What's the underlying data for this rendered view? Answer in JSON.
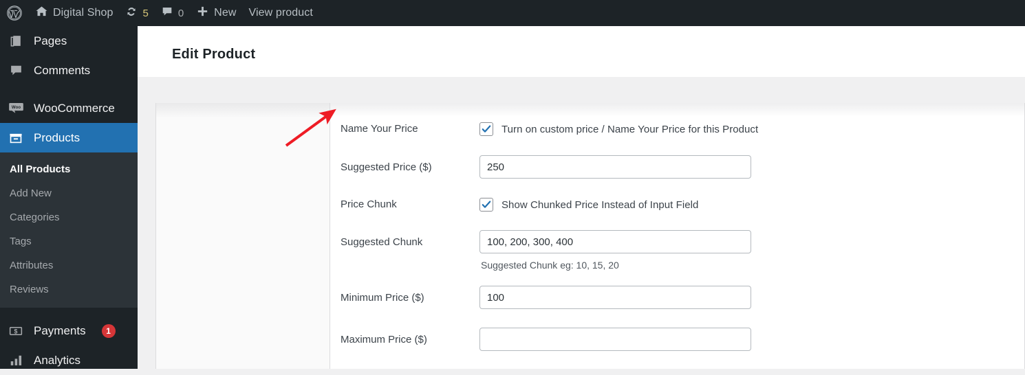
{
  "adminbar": {
    "wp_logo": "wordpress-logo-icon",
    "site": {
      "icon": "home-icon",
      "label": "Digital Shop"
    },
    "updates": {
      "icon": "updates-icon",
      "count": "5"
    },
    "comments": {
      "icon": "comment-bubble-icon",
      "count": "0"
    },
    "new": {
      "icon": "plus-icon",
      "label": "New"
    },
    "view_product": {
      "label": "View product"
    }
  },
  "sidebar": {
    "items": [
      {
        "label": "Pages",
        "icon": "pages-icon",
        "current": false
      },
      {
        "label": "Comments",
        "icon": "comment-icon",
        "current": false
      },
      {
        "label": "WooCommerce",
        "icon": "woo-icon",
        "current": false
      },
      {
        "label": "Products",
        "icon": "products-box-icon",
        "current": true
      },
      {
        "label": "Payments",
        "icon": "payments-icon",
        "badge": "1",
        "current": false
      },
      {
        "label": "Analytics",
        "icon": "analytics-bars-icon",
        "current": false
      }
    ],
    "submenu": [
      {
        "label": "All Products",
        "active": true
      },
      {
        "label": "Add New",
        "active": false
      },
      {
        "label": "Categories",
        "active": false
      },
      {
        "label": "Tags",
        "active": false
      },
      {
        "label": "Attributes",
        "active": false
      },
      {
        "label": "Reviews",
        "active": false
      }
    ]
  },
  "page": {
    "title": "Edit Product"
  },
  "form": {
    "name_your_price": {
      "label": "Name Your Price",
      "checkbox_label": "Turn on custom price / Name Your Price for this Product",
      "checked": true
    },
    "suggested_price": {
      "label": "Suggested Price ($)",
      "value": "250",
      "placeholder": ""
    },
    "price_chunk": {
      "label": "Price Chunk",
      "checkbox_label": "Show Chunked Price Instead of Input Field",
      "checked": true
    },
    "suggested_chunk": {
      "label": "Suggested Chunk",
      "value": "100, 200, 300, 400",
      "placeholder": "",
      "help": "Suggested Chunk eg: 10, 15, 20"
    },
    "minimum_price": {
      "label": "Minimum Price ($)",
      "value": "100",
      "placeholder": ""
    },
    "maximum_price": {
      "label": "Maximum Price ($)",
      "value": "",
      "placeholder": ""
    }
  },
  "annotation": {
    "arrow_color": "#ee1c25",
    "points_to": "Name Your Price"
  },
  "colors": {
    "admin_dark": "#1d2327",
    "admin_submenu": "#2c3338",
    "accent_blue": "#2271b1",
    "badge_red": "#d63638",
    "checkbox_blue": "#2271b1"
  }
}
